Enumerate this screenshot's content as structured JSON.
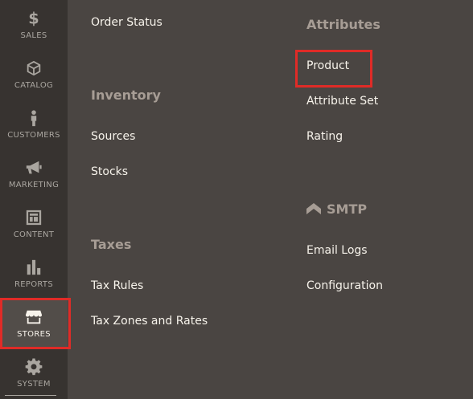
{
  "sidebar": {
    "items": [
      {
        "label": "SALES",
        "icon": "dollar-icon"
      },
      {
        "label": "CATALOG",
        "icon": "box-icon"
      },
      {
        "label": "CUSTOMERS",
        "icon": "person-icon"
      },
      {
        "label": "MARKETING",
        "icon": "megaphone-icon"
      },
      {
        "label": "CONTENT",
        "icon": "content-layout-icon"
      },
      {
        "label": "REPORTS",
        "icon": "bar-chart-icon"
      },
      {
        "label": "STORES",
        "icon": "store-icon",
        "active": true
      },
      {
        "label": "SYSTEM",
        "icon": "gear-icon"
      }
    ]
  },
  "submenu": {
    "left_column": {
      "order_status": "Order Status",
      "inventory": {
        "heading": "Inventory",
        "links": [
          "Sources",
          "Stocks"
        ]
      },
      "taxes": {
        "heading": "Taxes",
        "links": [
          "Tax Rules",
          "Tax Zones and Rates"
        ]
      }
    },
    "right_column": {
      "attributes": {
        "heading": "Attributes",
        "links": [
          "Product",
          "Attribute Set",
          "Rating"
        ]
      },
      "smtp": {
        "heading": "SMTP",
        "links": [
          "Email Logs",
          "Configuration"
        ]
      }
    }
  },
  "colors": {
    "sidebar_bg": "#373330",
    "panel_bg": "#4a4542",
    "highlight": "#e02b27",
    "active_item_bg": "#524d49"
  }
}
